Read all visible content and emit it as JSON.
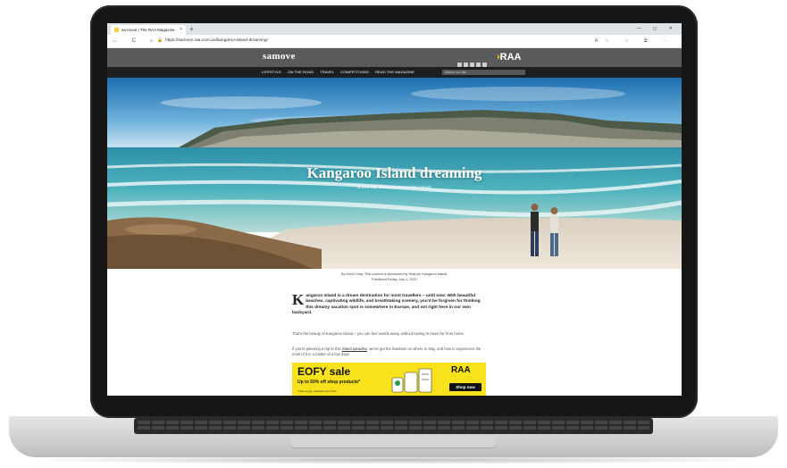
{
  "browser": {
    "tab_title": "sa-move | The RAA Magazine",
    "new_tab_glyph": "+",
    "close_glyph": "×",
    "window_controls": "— ◻ ✕",
    "nav_glyphs": "← C ⌂",
    "lock_glyph": "🔒",
    "url": "https://samove.raa.com.au/kangaroo-island-dreaming/",
    "tool_glyphs": "A☆ ☆ ⧉ ⋯"
  },
  "site": {
    "logo": "samove",
    "raa_logo": "RAA",
    "nav": [
      "LIFESTYLE",
      "ON THE ROAD",
      "TRAVEL",
      "COMPETITIONS",
      "READ THE MAGAZINE"
    ],
    "search_placeholder": "Search our site..."
  },
  "hero": {
    "title": "Kangaroo Island dreaming",
    "subtitle": "A four day itinerary around the island."
  },
  "article": {
    "byline": "By Kevin Gray. This content is sponsored by SeaLink Kangaroo Island.",
    "published": "Published Friday, July 1, 2022",
    "dropcap": "K",
    "intro": "angaroo Island is a dream destination for most travellers – until now. With beautiful beaches, captivating wildlife, and breathtaking scenery, you'd be forgiven for thinking this dreamy vacation spot is somewhere in Europe, and not right here in our own backyard.",
    "para1": "That's the beauty of Kangaroo Island – you can feel worlds away, without having to travel far from home.",
    "para2_a": "If you're planning a trip to this ",
    "para2_link": "island paradise",
    "para2_b": ", we've got the lowdown on where to stay, and how to experience the most of it in a matter of a few days."
  },
  "ad": {
    "title": "EOFY sale",
    "subtitle": "Up to 50% off shop products*",
    "note": "*T&Cs apply, available from RAA.",
    "brand": "RAA",
    "cta": "Shop now"
  },
  "colors": {
    "header_bg": "#5a5a5a",
    "nav_bg": "#1e1e1e",
    "raa_yellow": "#f5d400",
    "ad_yellow": "#f7e21b"
  }
}
